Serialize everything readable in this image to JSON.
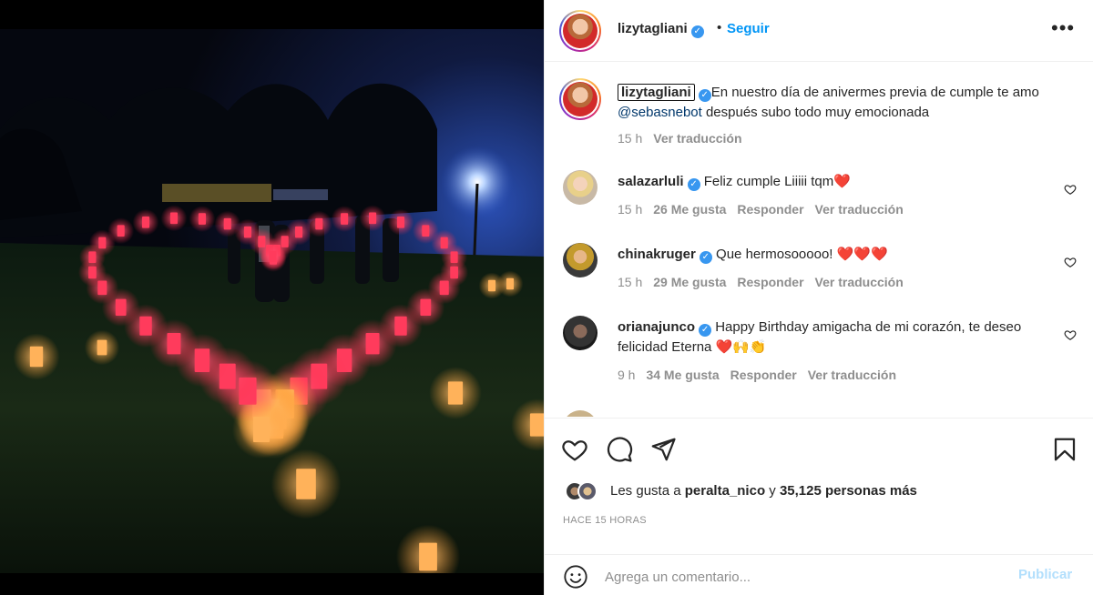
{
  "post": {
    "author": "lizytagliani",
    "follow_dot": "•",
    "follow_label": "Seguir",
    "more_icon": "more-options-icon"
  },
  "caption": {
    "author": "lizytagliani",
    "text_before": "En nuestro día de anivermes previa de cumple te amo ",
    "mention": "@sebasnebot",
    "text_after": " después subo todo muy emocionada",
    "time": "15 h",
    "translate": "Ver traducción"
  },
  "comments": [
    {
      "user": "salazarluli",
      "text": "Feliz cumple Liiiii tqm❤️",
      "time": "15 h",
      "likes": "26 Me gusta",
      "reply": "Responder",
      "translate": "Ver traducción"
    },
    {
      "user": "chinakruger",
      "text": "Que hermosooooo! ❤️❤️❤️",
      "time": "15 h",
      "likes": "29 Me gusta",
      "reply": "Responder",
      "translate": "Ver traducción"
    },
    {
      "user": "orianajunco",
      "text": "Happy Birthday amigacha de mi corazón, te deseo felicidad Eterna ❤️🙌👏",
      "time": "9 h",
      "likes": "34 Me gusta",
      "reply": "Responder",
      "translate": "Ver traducción"
    }
  ],
  "likes": {
    "prefix": "Les gusta a ",
    "user": "peralta_nico",
    "middle": " y ",
    "others": "35,125 personas más"
  },
  "time_ago": "HACE 15 HORAS",
  "comment_box": {
    "placeholder": "Agrega un comentario...",
    "publish_label": "Publicar"
  },
  "colors": {
    "accent": "#0095f6",
    "verified": "#3897f0",
    "heart": "#ed4956"
  }
}
